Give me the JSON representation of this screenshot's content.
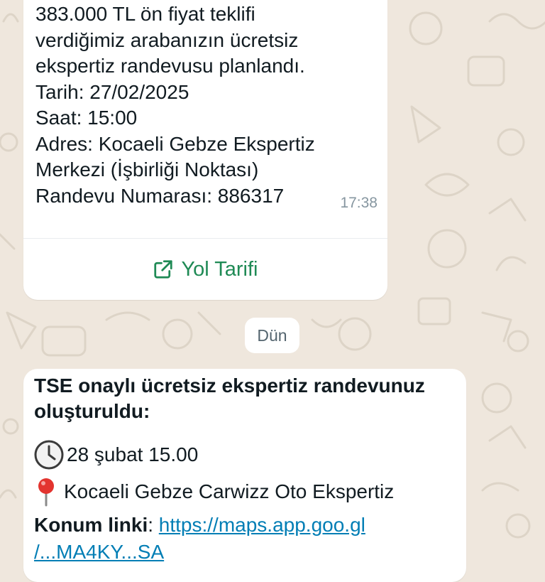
{
  "message_1": {
    "lines": [
      "383.000 TL ön fiyat teklifi",
      "verdiğimiz arabanızın ücretsiz",
      "ekspertiz randevusu planlandı.",
      "Tarih: 27/02/2025",
      "Saat: 15:00",
      "Adres: Kocaeli Gebze Ekspertiz",
      "Merkezi (İşbirliği Noktası)",
      "Randevu Numarası: 886317"
    ],
    "time": "17:38",
    "action_button": {
      "label": "Yol Tarifi",
      "icon": "external-link-icon"
    }
  },
  "date_divider": {
    "label": "Dün"
  },
  "message_2": {
    "title_line_1": "TSE onaylı ücretsiz ekspertiz randevunuz",
    "title_line_2": "oluşturuldu:",
    "date_line": {
      "icon": "clock-icon",
      "text": "28 şubat 15.00"
    },
    "location_line": {
      "icon": "pin-icon",
      "text": "Kocaeli Gebze Carwizz Oto Ekspertiz"
    },
    "link_label": "Konum linki",
    "link_separator": ": ",
    "link_url": "https://maps.app.goo.gl",
    "link_url_continued": "/...MA4KY...SA"
  },
  "colors": {
    "chat_background": "#efe7dd",
    "bubble": "#ffffff",
    "action_green": "#1f8a55",
    "link_blue": "#027eb5",
    "timestamp_gray": "#8696a0"
  }
}
